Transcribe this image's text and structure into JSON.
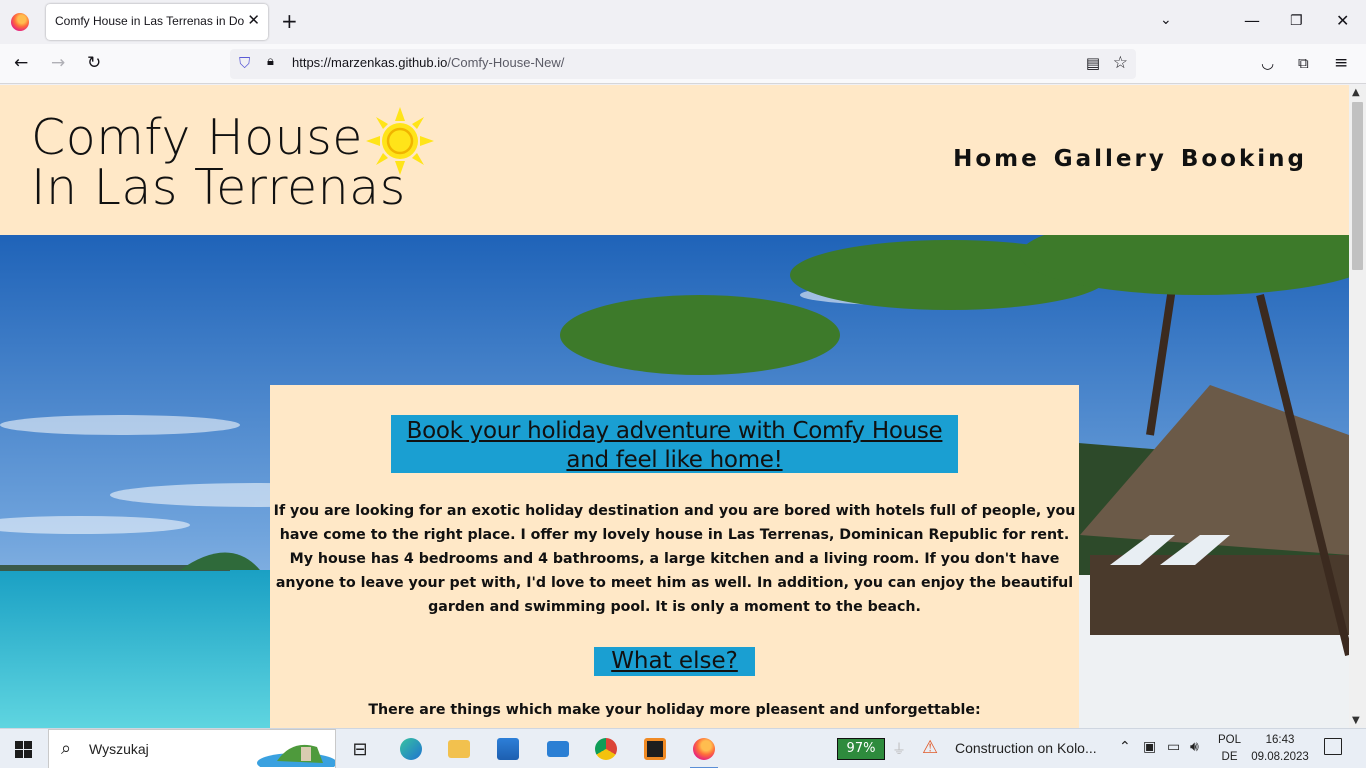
{
  "browser": {
    "tab_title": "Comfy House in Las Terrenas in Dominican Republic",
    "new_tab_label": "+",
    "url_host": "https://marzenkas.github.io",
    "url_path": "/Comfy-House-New/"
  },
  "site": {
    "title_line1": "Comfy House",
    "title_line2": "In Las Terrenas",
    "nav": [
      "Home",
      "Gallery",
      "Booking"
    ],
    "heading": "Book your holiday adventure with Comfy House and feel like home!",
    "intro": "If you are looking for an exotic holiday destination and you are bored with hotels full of people, you have come to the right place. I offer my lovely house in Las Terrenas, Dominican Republic for rent. My house has 4 bedrooms and 4 bathrooms, a large kitchen and a living room. If you don't have anyone to leave your pet with, I'd love to meet him as well. In addition, you can enjoy the beautiful garden and swimming pool. It is only a moment to the beach.",
    "subheading": "What else?",
    "things_text": "There are things which make your holiday more pleasent and unforgettable:",
    "colors": {
      "page_bg": "#ffe8c7",
      "heading_bg": "#1a9fd2",
      "sun": "#ffe419"
    }
  },
  "taskbar": {
    "search_text": "Wyszukaj",
    "battery": "97%",
    "notification": "Construction on Kolo...",
    "lang_line1": "POL",
    "lang_line2": "DE",
    "time": "16:43",
    "date": "09.08.2023"
  }
}
